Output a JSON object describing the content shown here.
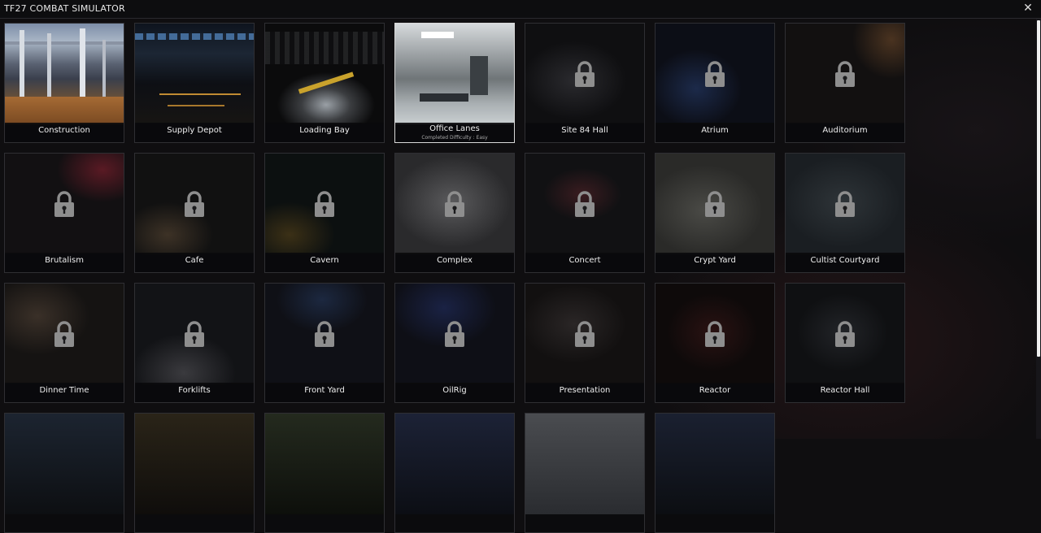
{
  "window": {
    "title": "TF27 COMBAT SIMULATOR",
    "close_glyph": "✕"
  },
  "maps": [
    {
      "name": "Construction",
      "locked": false,
      "selected": false,
      "subtitle": ""
    },
    {
      "name": "Supply Depot",
      "locked": false,
      "selected": false,
      "subtitle": ""
    },
    {
      "name": "Loading Bay",
      "locked": false,
      "selected": false,
      "subtitle": ""
    },
    {
      "name": "Office Lanes",
      "locked": false,
      "selected": true,
      "subtitle": "Completed Difficulty : Easy"
    },
    {
      "name": "Site 84 Hall",
      "locked": true,
      "selected": false,
      "subtitle": ""
    },
    {
      "name": "Atrium",
      "locked": true,
      "selected": false,
      "subtitle": ""
    },
    {
      "name": "Auditorium",
      "locked": true,
      "selected": false,
      "subtitle": ""
    },
    {
      "name": "Brutalism",
      "locked": true,
      "selected": false,
      "subtitle": ""
    },
    {
      "name": "Cafe",
      "locked": true,
      "selected": false,
      "subtitle": ""
    },
    {
      "name": "Cavern",
      "locked": true,
      "selected": false,
      "subtitle": ""
    },
    {
      "name": "Complex",
      "locked": true,
      "selected": false,
      "subtitle": ""
    },
    {
      "name": "Concert",
      "locked": true,
      "selected": false,
      "subtitle": ""
    },
    {
      "name": "Crypt Yard",
      "locked": true,
      "selected": false,
      "subtitle": ""
    },
    {
      "name": "Cultist Courtyard",
      "locked": true,
      "selected": false,
      "subtitle": ""
    },
    {
      "name": "Dinner Time",
      "locked": true,
      "selected": false,
      "subtitle": ""
    },
    {
      "name": "Forklifts",
      "locked": true,
      "selected": false,
      "subtitle": ""
    },
    {
      "name": "Front Yard",
      "locked": true,
      "selected": false,
      "subtitle": ""
    },
    {
      "name": "OilRig",
      "locked": true,
      "selected": false,
      "subtitle": ""
    },
    {
      "name": "Presentation",
      "locked": true,
      "selected": false,
      "subtitle": ""
    },
    {
      "name": "Reactor",
      "locked": true,
      "selected": false,
      "subtitle": ""
    },
    {
      "name": "Reactor Hall",
      "locked": true,
      "selected": false,
      "subtitle": ""
    }
  ],
  "icons": {
    "lock": "padlock-icon",
    "close": "close-icon"
  },
  "colors": {
    "selected_border": "#d9d9d9",
    "tile_border": "#2f2f33",
    "background": "#0f0e10"
  }
}
